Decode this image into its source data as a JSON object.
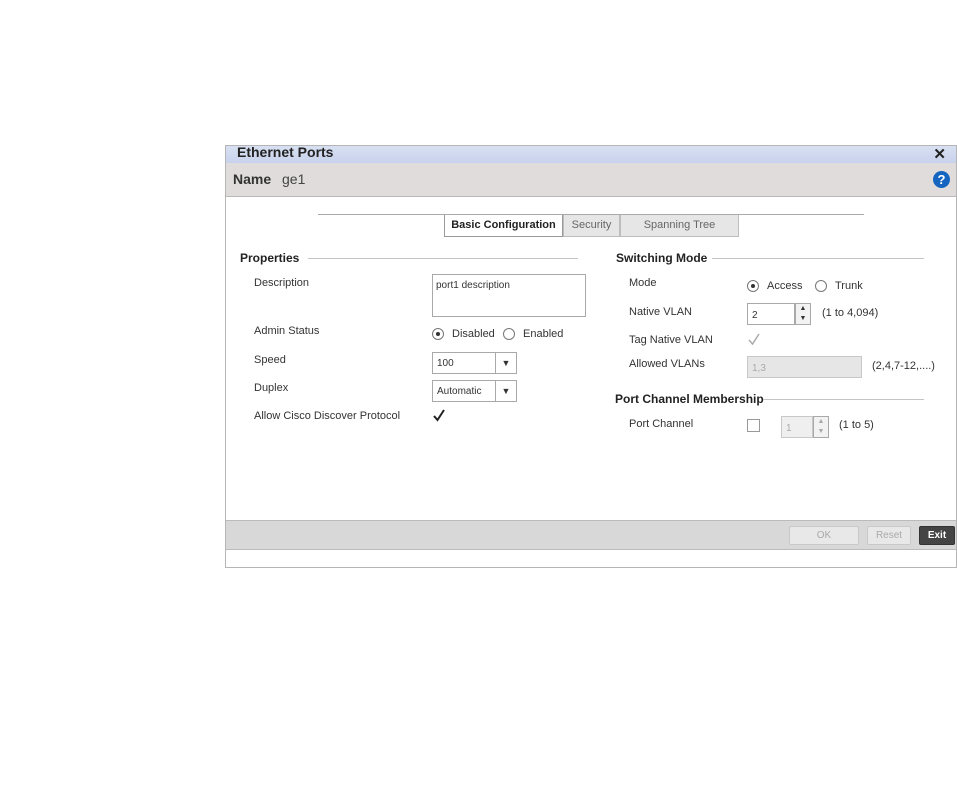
{
  "dialog": {
    "title": "Ethernet Ports",
    "close_glyph": "✕",
    "name_label": "Name",
    "name_value": "ge1",
    "help_glyph": "?"
  },
  "tabs": [
    {
      "label": "Basic Configuration",
      "active": true
    },
    {
      "label": "Security",
      "active": false
    },
    {
      "label": "Spanning Tree",
      "active": false
    }
  ],
  "properties": {
    "heading": "Properties",
    "description_label": "Description",
    "description_value": "port1 description",
    "admin_status_label": "Admin Status",
    "admin_disabled": "Disabled",
    "admin_enabled": "Enabled",
    "admin_selected": "Disabled",
    "speed_label": "Speed",
    "speed_value": "100",
    "duplex_label": "Duplex",
    "duplex_value": "Automatic",
    "cdp_label": "Allow Cisco Discover Protocol",
    "cdp_checked": true
  },
  "switching": {
    "heading": "Switching Mode",
    "mode_label": "Mode",
    "mode_access": "Access",
    "mode_trunk": "Trunk",
    "mode_selected": "Access",
    "native_vlan_label": "Native VLAN",
    "native_vlan_value": "2",
    "native_vlan_range": "(1 to 4,094)",
    "tag_native_label": "Tag Native VLAN",
    "tag_native_checked": true,
    "allowed_vlans_label": "Allowed VLANs",
    "allowed_vlans_value": "1,3",
    "allowed_vlans_hint": "(2,4,7-12,....)"
  },
  "port_channel": {
    "heading": "Port Channel Membership",
    "label": "Port Channel",
    "value": "1",
    "range": "(1 to 5)",
    "checked": false
  },
  "footer": {
    "ok": "OK",
    "reset": "Reset",
    "exit": "Exit"
  },
  "icons": {
    "close": "close-icon",
    "help": "help-icon",
    "dropdown": "chevron-down-icon",
    "check": "checkmark-icon"
  }
}
